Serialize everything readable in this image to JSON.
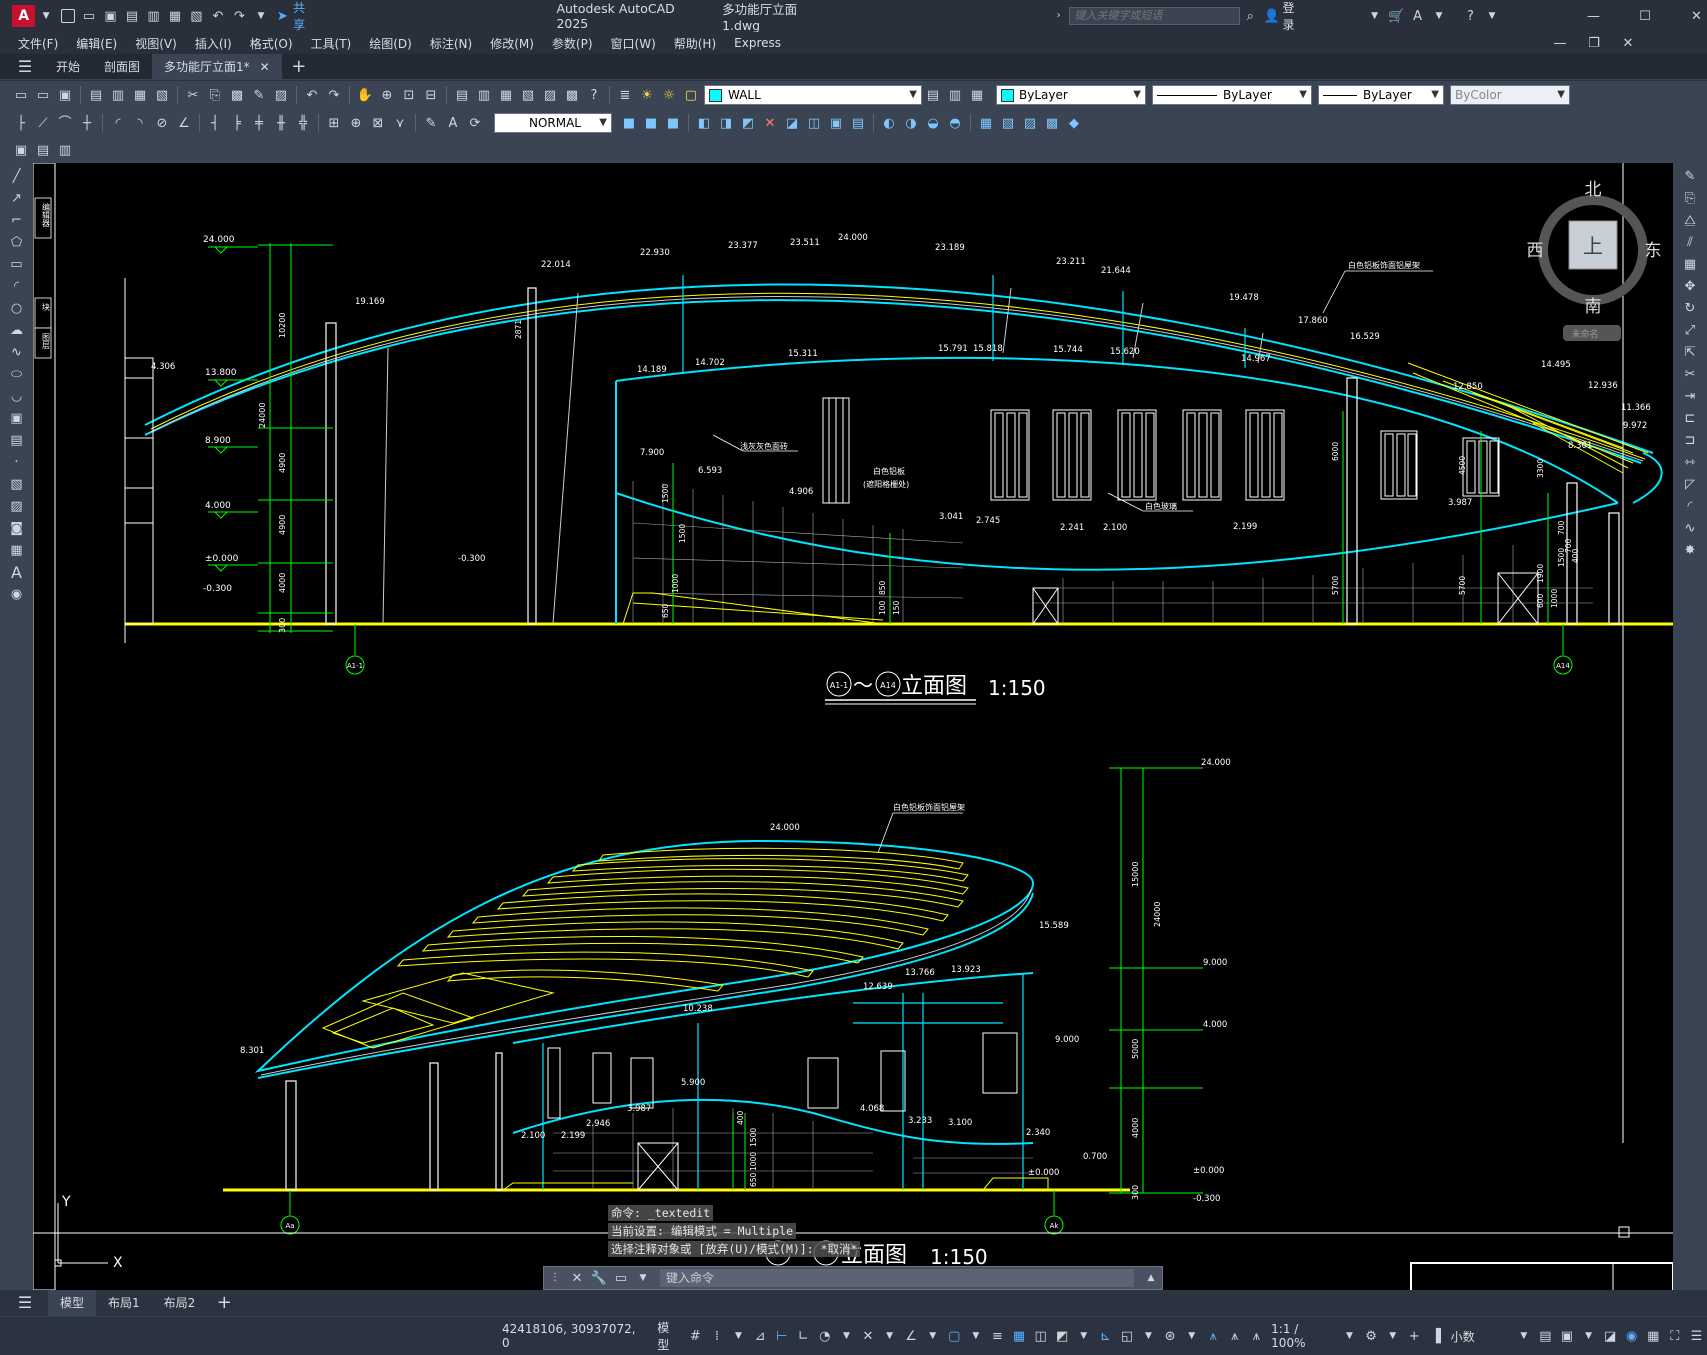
{
  "titlebar": {
    "app_title": "Autodesk AutoCAD 2025",
    "file_name": "多功能厅立面1.dwg",
    "share_label": "共享",
    "search_placeholder": "键入关键字或短语",
    "login_label": "登录",
    "app_letter": "A"
  },
  "menubar": {
    "items": [
      "文件(F)",
      "编辑(E)",
      "视图(V)",
      "插入(I)",
      "格式(O)",
      "工具(T)",
      "绘图(D)",
      "标注(N)",
      "修改(M)",
      "参数(P)",
      "窗口(W)",
      "帮助(H)",
      "Express"
    ]
  },
  "doc_tabs": {
    "items": [
      "开始",
      "剖面图",
      "多功能厅立面1*"
    ],
    "active": 2
  },
  "toolbar": {
    "layer_name": "WALL",
    "color": "ByLayer",
    "linetype": "ByLayer",
    "lineweight": "ByLayer",
    "plotstyle": "ByColor",
    "text_style": "NORMAL",
    "layer_color": "#00ffff"
  },
  "viewcube": {
    "north": "北",
    "south": "南",
    "east": "东",
    "west": "西",
    "top": "上",
    "ucs_label": "未命名"
  },
  "left_palette_labels": [
    "编辑器",
    "块",
    "图层"
  ],
  "command": {
    "history": [
      "命令: _textedit",
      "当前设置: 编辑模式 = Multiple",
      "选择注释对象或 [放弃(U)/模式(M)]: *取消*"
    ],
    "placeholder": "键入命令"
  },
  "layout_tabs": {
    "items": [
      "模型",
      "布局1",
      "布局2"
    ],
    "active": 0
  },
  "status": {
    "coords": "42418106, 30937072, 0",
    "mode": "模型",
    "scale": "1:1 / 100%",
    "units": "小数"
  },
  "drawing": {
    "elev1": {
      "title": "立面图",
      "scale": "1:150",
      "axis_from": "A1-1",
      "axis_to": "A14",
      "tilde": "～",
      "grid_bubbles": [
        "A1-1",
        "A14"
      ],
      "levels_left": [
        "24.000",
        "13.800",
        "8.900",
        "4.000",
        "±0.000",
        "-0.300"
      ],
      "dims_left": [
        "10200",
        "4900",
        "4900",
        "4000",
        "300"
      ],
      "dim_total": "24000",
      "roof_levels": [
        "4.306",
        "19.169",
        "22.014",
        "22.930",
        "23.377",
        "23.511",
        "24.000",
        "23.189",
        "23.211",
        "21.644",
        "19.478",
        "17.860",
        "16.529",
        "14.495",
        "12.936",
        "11.366",
        "9.972",
        "8.301",
        "12.850"
      ],
      "mid_levels": [
        "14.189",
        "14.702",
        "15.311",
        "15.791",
        "15.818",
        "15.744",
        "15.620",
        "14.967"
      ],
      "low_levels": [
        "7.900",
        "6.593",
        "4.906",
        "3.041",
        "2.745",
        "2.241",
        "2.100",
        "2.199",
        "3.987",
        "-0.300"
      ],
      "notes": [
        "白色铝板饰面铝屋架",
        "浅灰灰色面砖",
        "白色铝板",
        "(遮阳格栅处)",
        "白色玻璃"
      ],
      "dims_mid": [
        "6000",
        "4500",
        "3300",
        "5700",
        "5700",
        "1900",
        "700",
        "1500",
        "100",
        "850",
        "150",
        "600",
        "1000",
        "1500",
        "700",
        "400",
        "650",
        "1500",
        "1000"
      ],
      "post_label": "2871"
    },
    "elev2": {
      "title": "立面图",
      "scale": "1:150",
      "grid_bubbles": [
        "Aa",
        "Ak"
      ],
      "note": "白色铝板饰面铝屋架",
      "levels": [
        "24.000",
        "15.589",
        "13.766",
        "13.923",
        "12.639",
        "10.238",
        "8.301",
        "9.000",
        "5.900",
        "4.068",
        "3.987",
        "3.233",
        "3.100",
        "2.946",
        "2.340",
        "2.199",
        "2.100",
        "0.700",
        "±0.000"
      ],
      "right_levels": [
        "24.000",
        "9.000",
        "4.000",
        "±0.000",
        "-0.300"
      ],
      "right_dims": [
        "15000",
        "24000",
        "5000",
        "4000",
        "300"
      ],
      "dims_mid": [
        "400",
        "1500",
        "1000",
        "650"
      ]
    },
    "ucs": {
      "x": "X",
      "y": "Y"
    }
  },
  "colors": {
    "cyan": "#00e5ff",
    "yellow": "#ffff00",
    "green": "#00ff00",
    "white": "#ffffff",
    "grey": "#b0b0b0"
  }
}
